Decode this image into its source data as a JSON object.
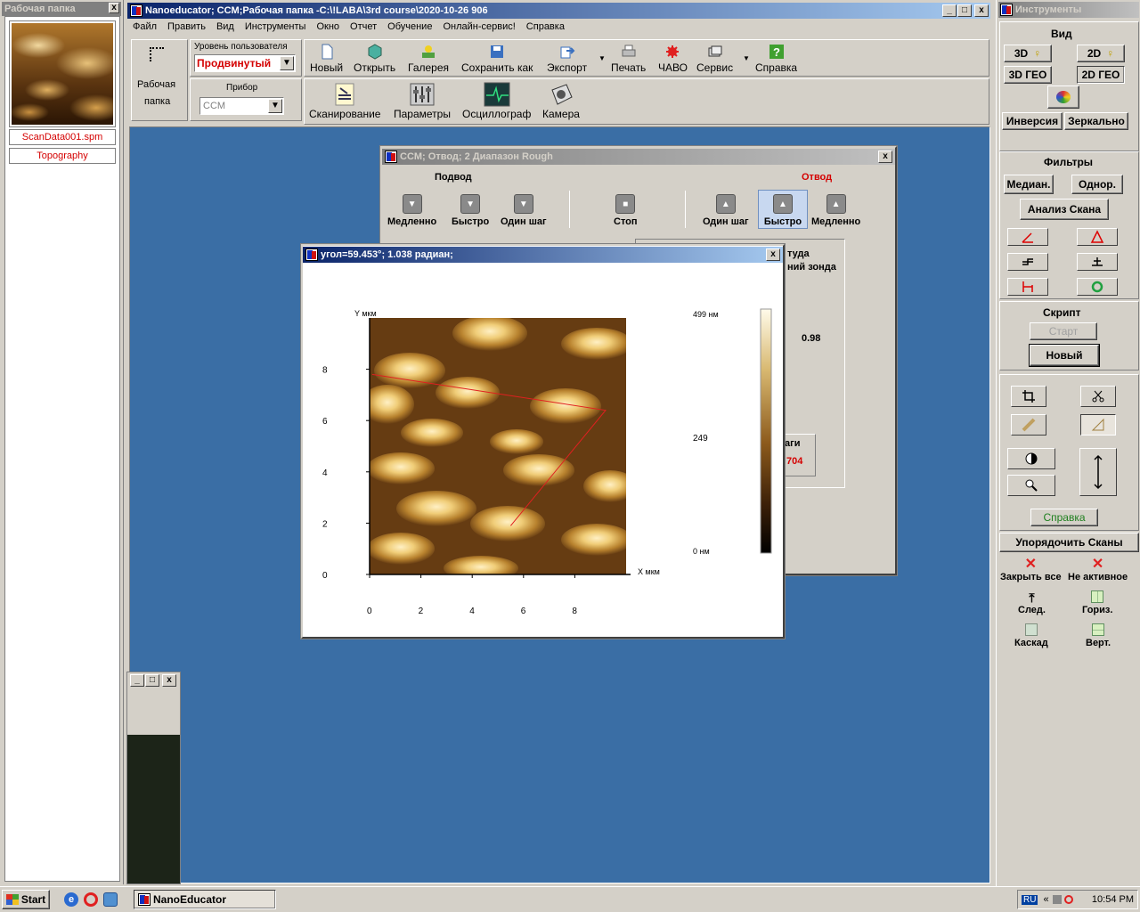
{
  "left_panel": {
    "title": "Рабочая папка",
    "close": "x",
    "file_name": "ScanData001.spm",
    "file_type": "Topography"
  },
  "main_window": {
    "title": "Nanoeducator; CCM;Рабочая папка -C:\\!LABA\\3rd course\\2020-10-26 906",
    "menu": [
      "Файл",
      "Править",
      "Вид",
      "Инструменты",
      "Окно",
      "Отчет",
      "Обучение",
      "Онлайн-сервис!",
      "Справка"
    ]
  },
  "toolbar": {
    "workfolder_line1": "Рабочая",
    "workfolder_line2": "папка",
    "user_level_label": "Уровень пользователя",
    "user_level_value": "Продвинутый",
    "device_label": "Прибор",
    "device_value": "CCM",
    "buttons": {
      "new": "Новый",
      "open": "Открыть",
      "gallery": "Галерея",
      "save_as": "Сохранить как",
      "export": "Экспорт",
      "print": "Печать",
      "faq": "ЧАВО",
      "service": "Сервис",
      "help": "Справка"
    },
    "buttons2": {
      "scan": "Сканирование",
      "params": "Параметры",
      "scope": "Осциллограф",
      "camera": "Камера"
    }
  },
  "ccm_dialog": {
    "title": "CCM;  Отвод; 2 Диапазон Rough",
    "approach_label": "Подвод",
    "retract_label": "Отвод",
    "slow": "Медленно",
    "fast": "Быстро",
    "one_step": "Один шаг",
    "stop": "Стоп",
    "one_step_r": "Один шаг",
    "fast_r": "Быстро",
    "slow_r": "Медленно",
    "amp_label1": "туда",
    "amp_label2": "ний зонда",
    "amp_value": "0.98",
    "steps_label": "аги",
    "steps_value": "704"
  },
  "image_window": {
    "title": "угол=59.453°; 1.038 радиан;",
    "close": "x",
    "y_label": "Y мкм",
    "x_label": "X мкм",
    "y_ticks": [
      "8",
      "6",
      "4",
      "2",
      "0"
    ],
    "x_ticks": [
      "0",
      "2",
      "4",
      "6",
      "8"
    ],
    "scale_top": "499 нм",
    "scale_mid": "249",
    "scale_bot": "0 нм"
  },
  "chart_data": {
    "type": "heatmap",
    "title": "угол=59.453°; 1.038 радиан;",
    "xlabel": "X мкм",
    "ylabel": "Y мкм",
    "xlim": [
      0,
      10
    ],
    "ylim": [
      0,
      10
    ],
    "x_ticks": [
      0,
      2,
      4,
      6,
      8
    ],
    "y_ticks": [
      0,
      2,
      4,
      6,
      8
    ],
    "colorbar": {
      "min": "0 нм",
      "mid": "249",
      "max": "499 нм"
    },
    "angle_deg": 59.453,
    "angle_rad": 1.038,
    "angle_line": [
      {
        "x": 0.1,
        "y": 7.8
      },
      {
        "x": 9.2,
        "y": 6.4
      },
      {
        "x": 5.5,
        "y": 1.9
      }
    ],
    "colors": {
      "line": "#e02020"
    }
  },
  "mini_window": {
    "min": "_",
    "max": "□",
    "close": "x"
  },
  "tools": {
    "title": "Инструменты",
    "view_label": "Вид",
    "b3d": "3D",
    "b2d": "2D",
    "b3dgeo": "3D ГЕО",
    "b2dgeo": "2D ГЕО",
    "inverse": "Инверсия",
    "mirror": "Зеркально",
    "filters_label": "Фильтры",
    "median": "Медиан.",
    "uniform": "Однор.",
    "analysis": "Анализ Скана",
    "script_label": "Скрипт",
    "start": "Старт",
    "new": "Новый",
    "help": "Справка",
    "arrange": "Упорядочить Сканы",
    "close_all": "Закрыть все",
    "inactive": "Не активное",
    "next": "След.",
    "horiz": "Гориз.",
    "cascade": "Каскад",
    "vert": "Верт."
  },
  "taskbar": {
    "start": "Start",
    "app": "NanoEducator",
    "lang": "RU",
    "time": "10:54 PM"
  },
  "colors": {
    "desktop": "#3a6ea5",
    "titlebar_active": "#0a246a",
    "titlebar_inactive": "#808080",
    "red_text": "#d40000"
  }
}
